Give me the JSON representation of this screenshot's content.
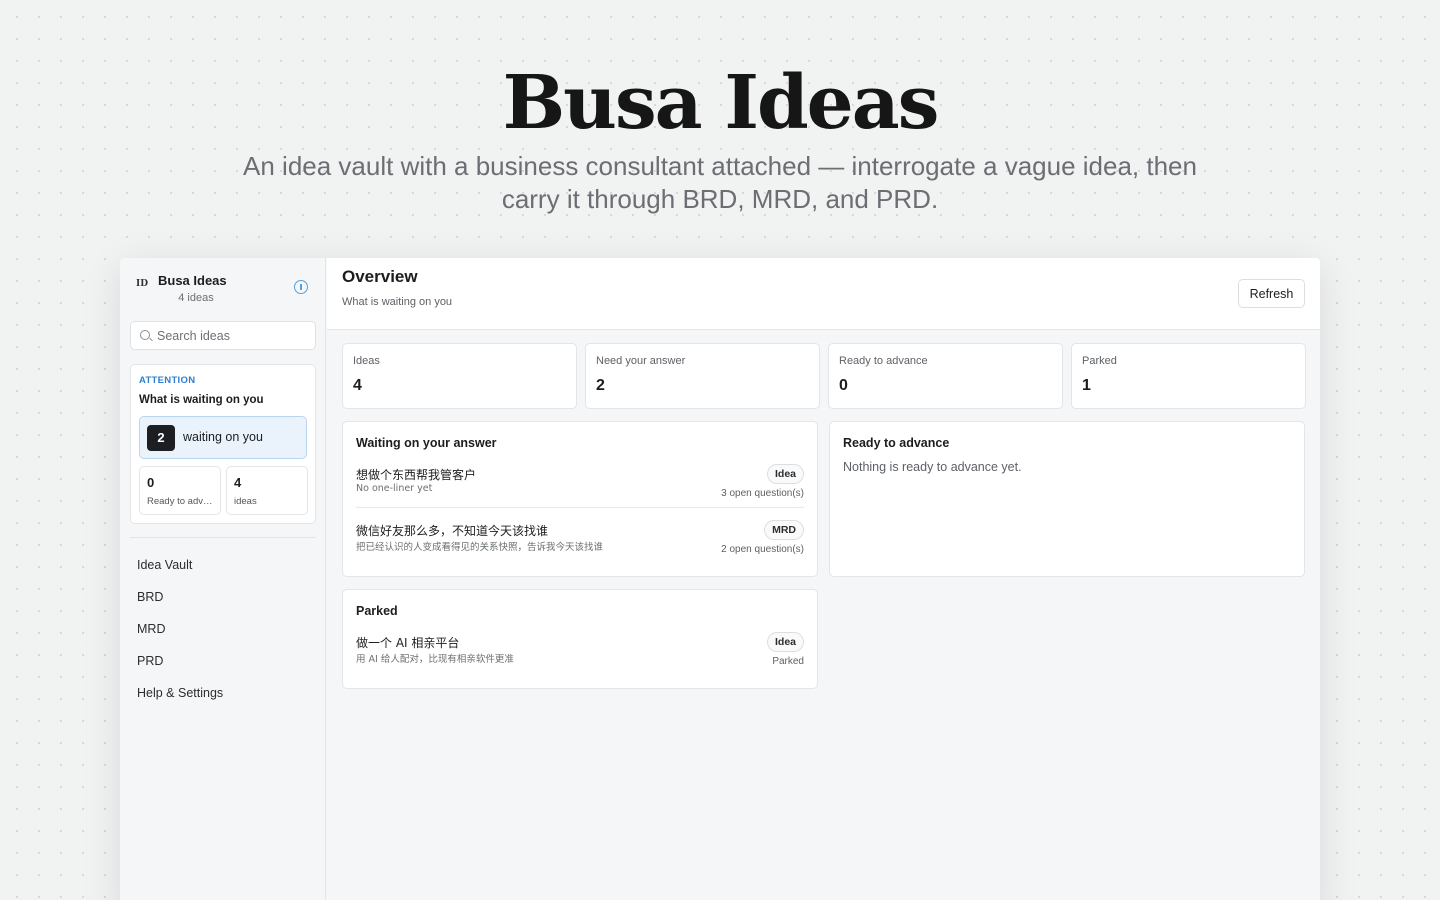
{
  "hero": {
    "title": "Busa Ideas",
    "subtitle": "An idea vault with a business consultant attached — interrogate a vague idea, then carry it through BRD, MRD, and PRD."
  },
  "sidebar": {
    "brand_mark": "ID",
    "brand_name": "Busa Ideas",
    "brand_count": "4 ideas",
    "search_placeholder": "Search ideas",
    "attention": {
      "label": "ATTENTION",
      "title": "What is waiting on you",
      "waiting_count": "2",
      "waiting_label": "waiting on you",
      "ready_count": "0",
      "ready_label": "Ready to advance",
      "ideas_count": "4",
      "ideas_label": "ideas"
    },
    "nav": [
      {
        "label": "Idea Vault"
      },
      {
        "label": "BRD"
      },
      {
        "label": "MRD"
      },
      {
        "label": "PRD"
      },
      {
        "label": "Help & Settings"
      }
    ]
  },
  "header": {
    "title": "Overview",
    "subtitle": "What is waiting on you",
    "refresh_label": "Refresh"
  },
  "stats": [
    {
      "label": "Ideas",
      "value": "4"
    },
    {
      "label": "Need your answer",
      "value": "2"
    },
    {
      "label": "Ready to advance",
      "value": "0"
    },
    {
      "label": "Parked",
      "value": "1"
    }
  ],
  "waiting_panel": {
    "title": "Waiting on your answer",
    "items": [
      {
        "title": "想做个东西帮我管客户",
        "subtitle": "No one-liner yet",
        "tag": "Idea",
        "meta": "3 open question(s)"
      },
      {
        "title": "微信好友那么多，不知道今天该找谁",
        "subtitle": "把已经认识的人变成看得见的关系快照，告诉我今天该找谁",
        "tag": "MRD",
        "meta": "2 open question(s)"
      }
    ]
  },
  "ready_panel": {
    "title": "Ready to advance",
    "empty": "Nothing is ready to advance yet."
  },
  "parked_panel": {
    "title": "Parked",
    "items": [
      {
        "title": "做一个 AI 相亲平台",
        "subtitle": "用 AI 给人配对，比现有相亲软件更准",
        "tag": "Idea",
        "meta": "Parked"
      }
    ]
  }
}
